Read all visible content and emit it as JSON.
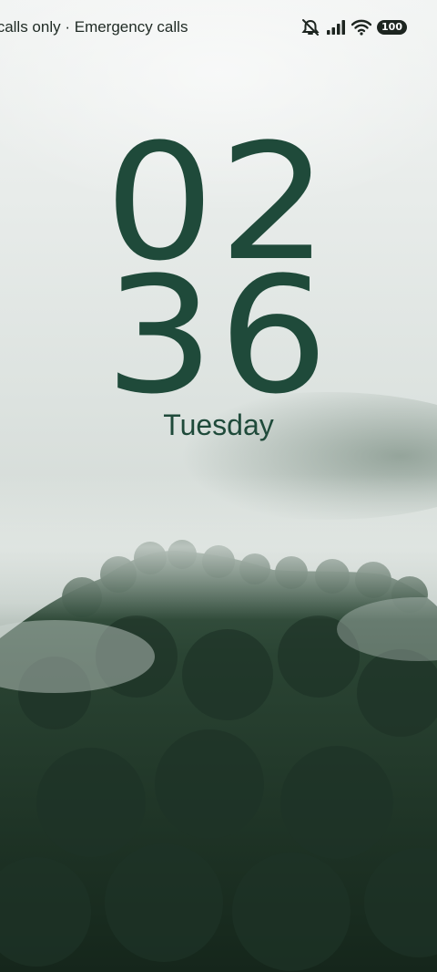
{
  "status_bar": {
    "carrier_text": "Emergency calls only  ·  Emergency calls only",
    "icons": [
      "silent-mode-icon",
      "signal-icon",
      "wifi-icon",
      "battery-icon"
    ],
    "battery_level": "100"
  },
  "clock": {
    "hours": "02",
    "minutes": "36",
    "day": "Tuesday"
  },
  "colors": {
    "clock": "#1f4a3a",
    "status_text": "#1f2a24"
  }
}
